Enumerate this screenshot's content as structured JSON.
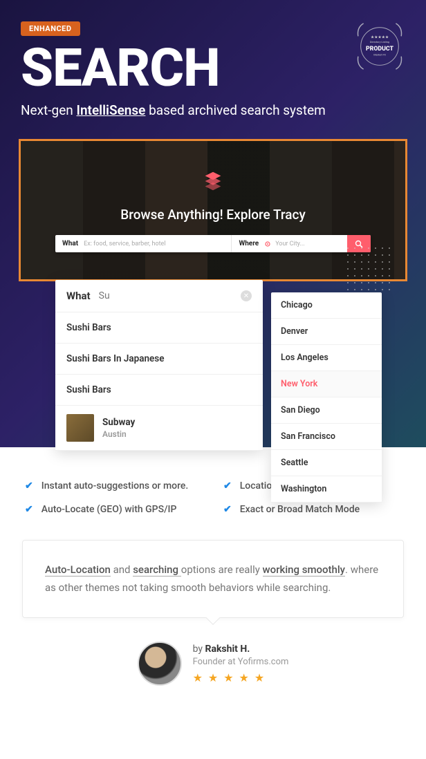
{
  "badge": "ENHANCED",
  "title": "SEARCH",
  "subtitle_pre": "Next-gen ",
  "subtitle_u": "IntelliSense",
  "subtitle_post": " based archived search system",
  "product_seal": {
    "top": "Directory Listing",
    "mid": "PRODUCT",
    "bot": "Market Fit"
  },
  "demo": {
    "tagline": "Browse Anything! Explore Tracy",
    "what_label": "What",
    "what_placeholder": "Ex: food, service, barber, hotel",
    "where_label": "Where",
    "where_placeholder": "Your City..."
  },
  "what_dd": {
    "label": "What",
    "input": "Su",
    "items": [
      "Sushi Bars",
      "Sushi Bars In Japanese",
      "Sushi Bars"
    ],
    "biz": {
      "name": "Subway",
      "loc": "Austin"
    }
  },
  "where_dd": {
    "cities": [
      "Chicago",
      "Denver",
      "Los Angeles",
      "New York",
      "San Diego",
      "San Francisco",
      "Seattle",
      "Washington"
    ],
    "active": "New York"
  },
  "features": [
    "Instant auto-suggestions or more.",
    "Location by Admin or Google",
    "Auto-Locate (GEO) with GPS/IP",
    "Exact or Broad Match Mode"
  ],
  "quote": {
    "s1": "Auto-Location",
    "t1": " and ",
    "s2": "searching ",
    "t2": "options are really ",
    "s3": "working smoothly",
    "t3": ". where as other themes not taking smooth behaviors while searching."
  },
  "author": {
    "by_pre": "by ",
    "name": "Rakshit H.",
    "role": "Founder at Yofirms.com",
    "stars": "★ ★ ★ ★ ★"
  }
}
